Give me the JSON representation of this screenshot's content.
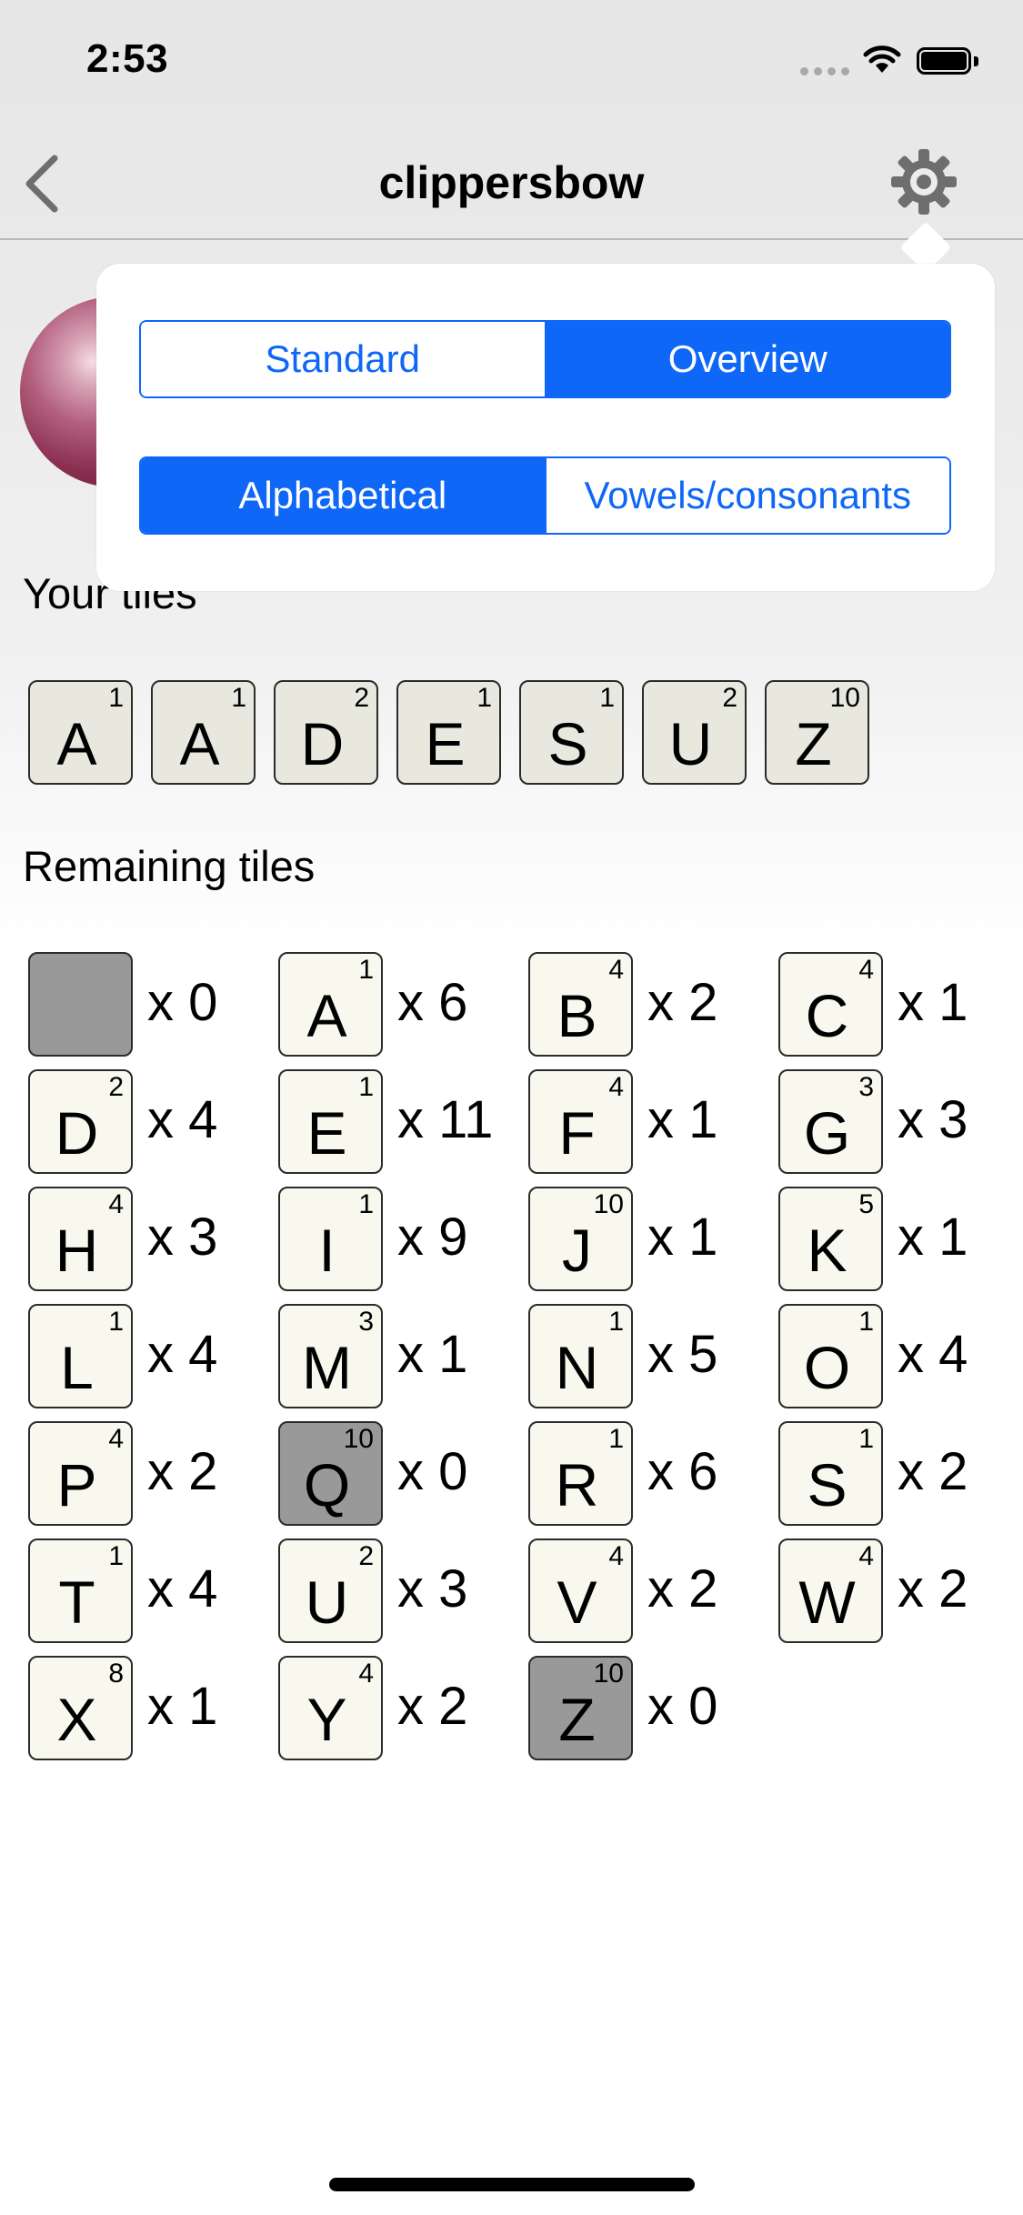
{
  "status_bar": {
    "time": "2:53"
  },
  "nav": {
    "title": "clippersbow"
  },
  "popover": {
    "view_options": [
      {
        "label": "Standard",
        "selected": false
      },
      {
        "label": "Overview",
        "selected": true
      }
    ],
    "order_options": [
      {
        "label": "Alphabetical",
        "selected": true
      },
      {
        "label": "Vowels/consonants",
        "selected": false
      }
    ]
  },
  "your_tiles": {
    "title": "Your tiles",
    "tiles": [
      {
        "letter": "A",
        "points": "1"
      },
      {
        "letter": "A",
        "points": "1"
      },
      {
        "letter": "D",
        "points": "2"
      },
      {
        "letter": "E",
        "points": "1"
      },
      {
        "letter": "S",
        "points": "1"
      },
      {
        "letter": "U",
        "points": "2"
      },
      {
        "letter": "Z",
        "points": "10"
      }
    ]
  },
  "remaining_tiles": {
    "title": "Remaining tiles",
    "tiles": [
      {
        "letter": "",
        "points": "",
        "count": "x 0",
        "used": true
      },
      {
        "letter": "A",
        "points": "1",
        "count": "x 6",
        "used": false
      },
      {
        "letter": "B",
        "points": "4",
        "count": "x 2",
        "used": false
      },
      {
        "letter": "C",
        "points": "4",
        "count": "x 1",
        "used": false
      },
      {
        "letter": "D",
        "points": "2",
        "count": "x 4",
        "used": false
      },
      {
        "letter": "E",
        "points": "1",
        "count": "x 11",
        "used": false
      },
      {
        "letter": "F",
        "points": "4",
        "count": "x 1",
        "used": false
      },
      {
        "letter": "G",
        "points": "3",
        "count": "x 3",
        "used": false
      },
      {
        "letter": "H",
        "points": "4",
        "count": "x 3",
        "used": false
      },
      {
        "letter": "I",
        "points": "1",
        "count": "x 9",
        "used": false
      },
      {
        "letter": "J",
        "points": "10",
        "count": "x 1",
        "used": false
      },
      {
        "letter": "K",
        "points": "5",
        "count": "x 1",
        "used": false
      },
      {
        "letter": "L",
        "points": "1",
        "count": "x 4",
        "used": false
      },
      {
        "letter": "M",
        "points": "3",
        "count": "x 1",
        "used": false
      },
      {
        "letter": "N",
        "points": "1",
        "count": "x 5",
        "used": false
      },
      {
        "letter": "O",
        "points": "1",
        "count": "x 4",
        "used": false
      },
      {
        "letter": "P",
        "points": "4",
        "count": "x 2",
        "used": false
      },
      {
        "letter": "Q",
        "points": "10",
        "count": "x 0",
        "used": true
      },
      {
        "letter": "R",
        "points": "1",
        "count": "x 6",
        "used": false
      },
      {
        "letter": "S",
        "points": "1",
        "count": "x 2",
        "used": false
      },
      {
        "letter": "T",
        "points": "1",
        "count": "x 4",
        "used": false
      },
      {
        "letter": "U",
        "points": "2",
        "count": "x 3",
        "used": false
      },
      {
        "letter": "V",
        "points": "4",
        "count": "x 2",
        "used": false
      },
      {
        "letter": "W",
        "points": "4",
        "count": "x 2",
        "used": false
      },
      {
        "letter": "X",
        "points": "8",
        "count": "x 1",
        "used": false
      },
      {
        "letter": "Y",
        "points": "4",
        "count": "x 2",
        "used": false
      },
      {
        "letter": "Z",
        "points": "10",
        "count": "x 0",
        "used": true
      }
    ]
  },
  "colors": {
    "accent": "#0f67f7",
    "tile_face": "#f8f8ee",
    "tile_used": "#999999",
    "avatar": "#8a2f50"
  },
  "icons": {
    "back": "chevron-left-icon",
    "settings": "gear-icon",
    "wifi": "wifi-icon",
    "battery": "battery-icon"
  }
}
